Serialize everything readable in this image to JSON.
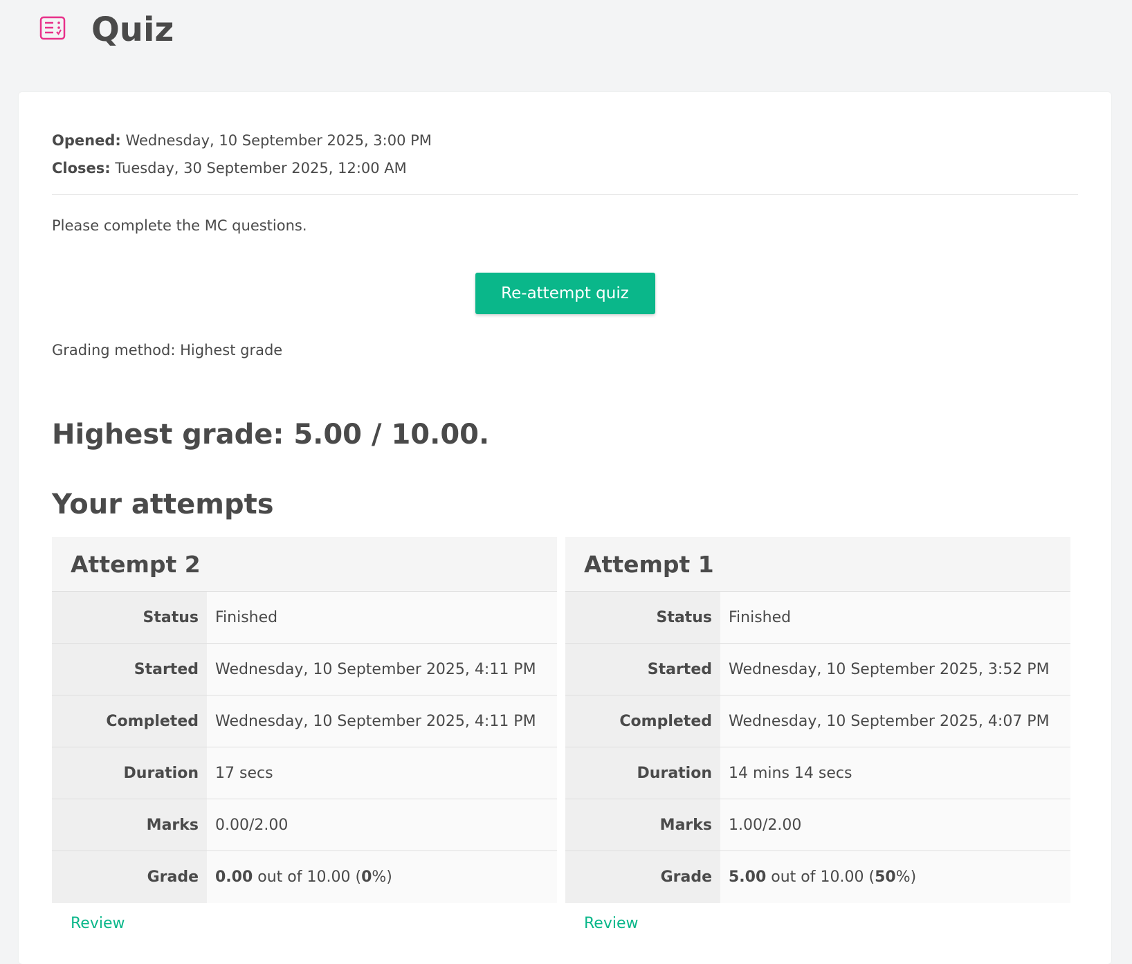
{
  "header": {
    "title": "Quiz",
    "icon": "quiz-checklist-icon",
    "icon_color": "#e8308a"
  },
  "dates": {
    "opened_label": "Opened:",
    "opened_value": "Wednesday, 10 September 2025, 3:00 PM",
    "closes_label": "Closes:",
    "closes_value": "Tuesday, 30 September 2025, 12:00 AM"
  },
  "intro": "Please complete the MC questions.",
  "actions": {
    "reattempt_label": "Re-attempt quiz",
    "accent": "#0ab78a"
  },
  "grading_method": "Grading method: Highest grade",
  "highest_grade": "Highest grade: 5.00 / 10.00.",
  "attempts_title": "Your attempts",
  "attempts": [
    {
      "title": "Attempt 2",
      "status_label": "Status",
      "status": "Finished",
      "started_label": "Started",
      "started": "Wednesday, 10 September 2025, 4:11 PM",
      "completed_label": "Completed",
      "completed": "Wednesday, 10 September 2025, 4:11 PM",
      "duration_label": "Duration",
      "duration": "17 secs",
      "marks_label": "Marks",
      "marks": "0.00/2.00",
      "grade_label": "Grade",
      "grade_value": "0.00",
      "grade_outof": " out of 10.00 (",
      "grade_pct": "0",
      "grade_tail": "%)",
      "review_label": "Review"
    },
    {
      "title": "Attempt 1",
      "status_label": "Status",
      "status": "Finished",
      "started_label": "Started",
      "started": "Wednesday, 10 September 2025, 3:52 PM",
      "completed_label": "Completed",
      "completed": "Wednesday, 10 September 2025, 4:07 PM",
      "duration_label": "Duration",
      "duration": "14 mins 14 secs",
      "marks_label": "Marks",
      "marks": "1.00/2.00",
      "grade_label": "Grade",
      "grade_value": "5.00",
      "grade_outof": " out of 10.00 (",
      "grade_pct": "50",
      "grade_tail": "%)",
      "review_label": "Review"
    }
  ]
}
